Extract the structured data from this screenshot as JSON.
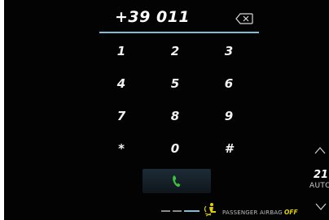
{
  "dialer": {
    "number": "+39 011",
    "keys": [
      "1",
      "2",
      "3",
      "4",
      "5",
      "6",
      "7",
      "8",
      "9",
      "*",
      "0",
      "#"
    ],
    "call_icon": "phone-icon",
    "call_color": "#3fbf3f",
    "backspace_icon": "backspace-icon",
    "accent_color": "#7dbdd6"
  },
  "status_bar": {
    "airbag_icon": "passenger-airbag-icon",
    "airbag_label": "PASSENGER AIRBAG",
    "airbag_state": "OFF",
    "airbag_state_color": "#e0d000"
  },
  "climate": {
    "temperature": "21°",
    "mode": "AUTO",
    "up_icon": "chevron-up-icon",
    "down_icon": "chevron-down-icon"
  }
}
